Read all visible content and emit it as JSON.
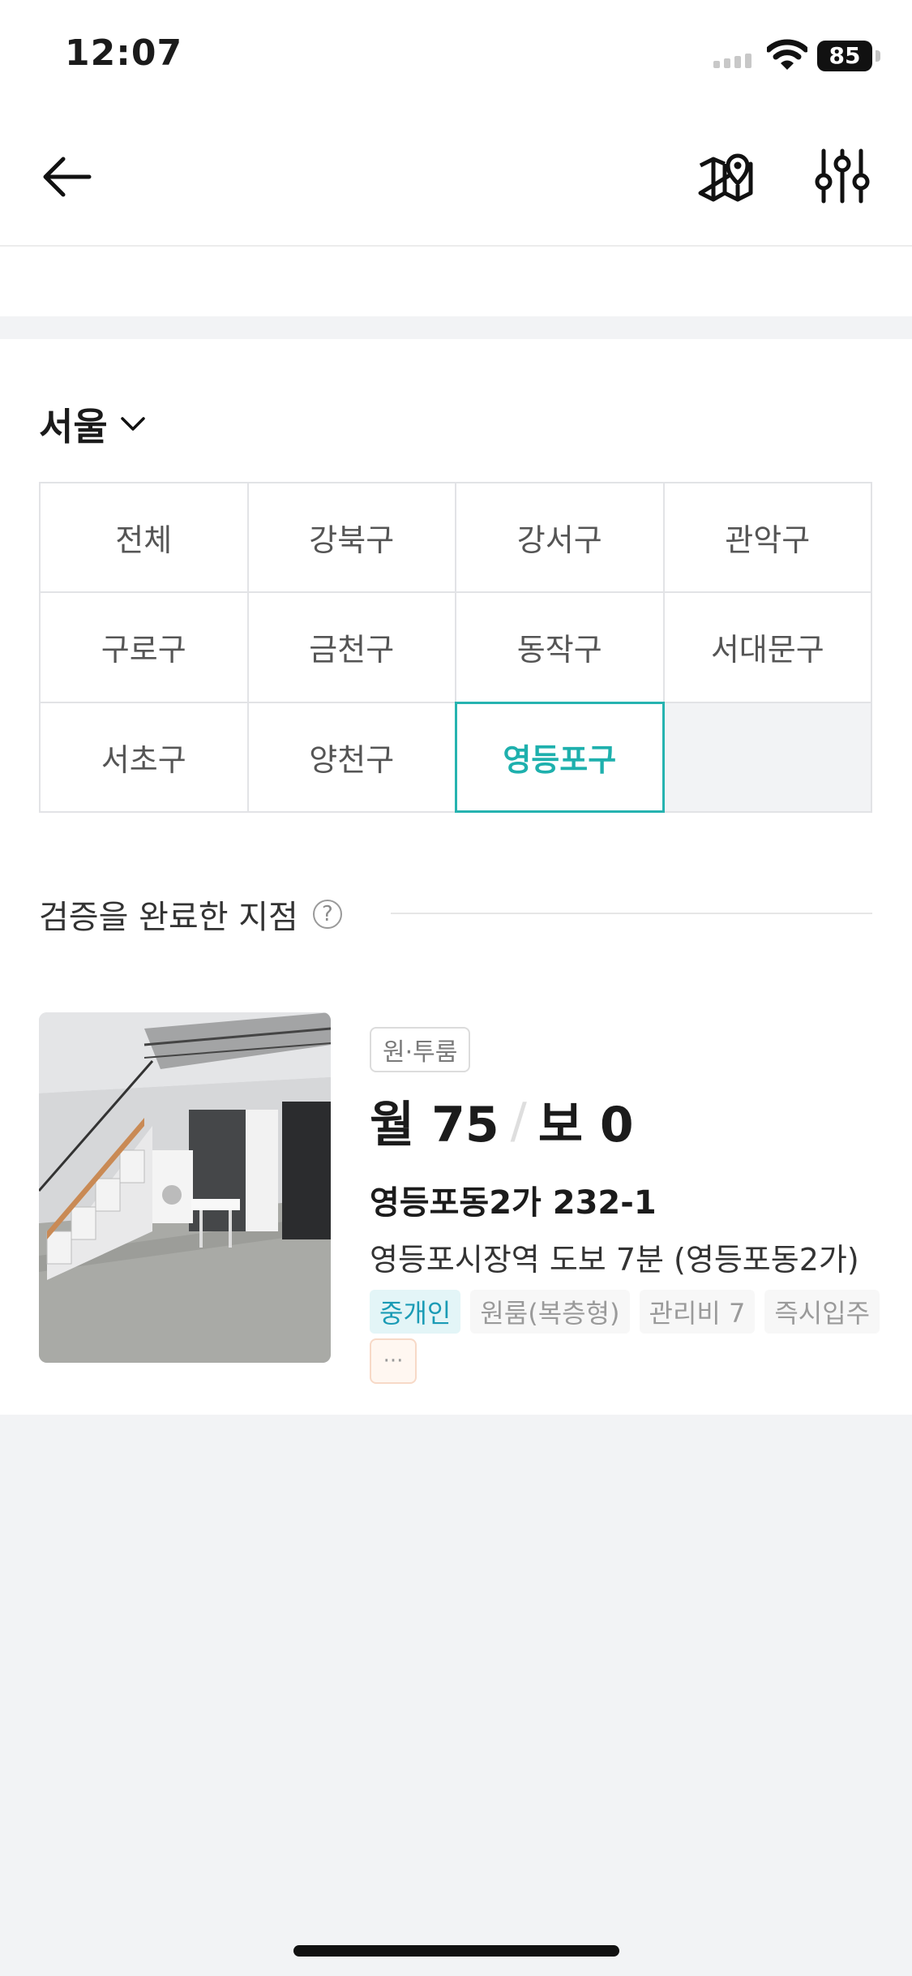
{
  "status_bar": {
    "time": "12:07",
    "battery": "85"
  },
  "region": {
    "title": "서울",
    "districts": [
      "전체",
      "강북구",
      "강서구",
      "관악구",
      "구로구",
      "금천구",
      "동작구",
      "서대문구",
      "서초구",
      "양천구",
      "영등포구"
    ],
    "selected": "영등포구"
  },
  "section": {
    "title": "검증을 완료한 지점",
    "help": "?"
  },
  "listing": {
    "room_type": "원·투룸",
    "price_monthly": "월 75",
    "price_deposit": "보 0",
    "address": "영등포동2가 232-1",
    "description": "영등포시장역 도보 7분 (영등포동2가)",
    "chips": [
      "중개인",
      "원룸(복층형)",
      "관리비 7",
      "즉시입주"
    ],
    "more": "···"
  },
  "colors": {
    "accent": "#26b3b0",
    "broker_chip_bg": "#e3f5f7",
    "broker_chip_text": "#1a9bb5"
  }
}
